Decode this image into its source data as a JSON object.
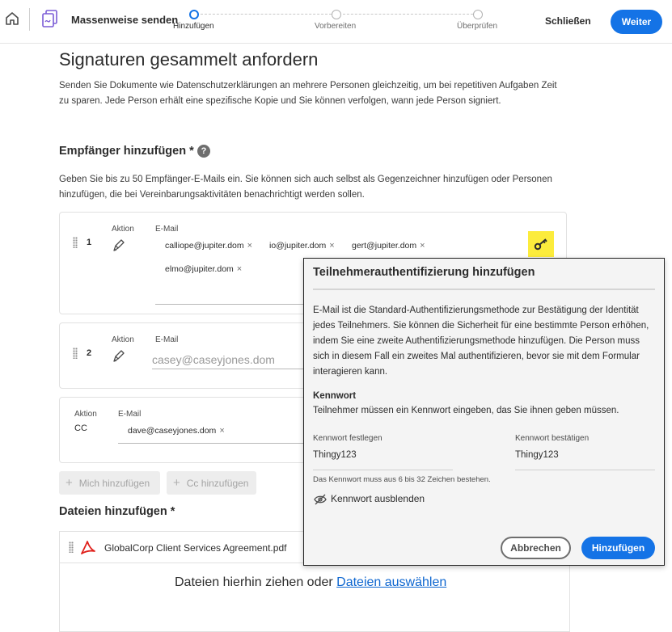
{
  "header": {
    "title": "Massenweise senden",
    "steps": [
      "Hinzufügen",
      "Vorbereiten",
      "Überprüfen"
    ],
    "close_label": "Schließen",
    "next_label": "Weiter"
  },
  "page": {
    "title": "Signaturen gesammelt anfordern",
    "intro": "Senden Sie Dokumente wie Datenschutzerklärungen an mehrere Personen gleichzeitig, um bei repetitiven Aufgaben Zeit zu sparen. Jede Person erhält eine spezifische Kopie und Sie können verfolgen, wann jede Person signiert."
  },
  "recipients": {
    "heading": "Empfänger hinzufügen *",
    "help": "?",
    "description": "Geben Sie bis zu 50 Empfänger-E-Mails ein. Sie können sich auch selbst als Gegenzeichner hinzufügen oder Personen hinzufügen, die bei Vereinbarungsaktivitäten benachrichtigt werden sollen.",
    "action_label": "Aktion",
    "email_label": "E-Mail",
    "row1": {
      "number": "1",
      "emails": [
        "calliope@jupiter.dom",
        "io@jupiter.dom",
        "gert@jupiter.dom",
        "elmo@jupiter.dom"
      ]
    },
    "row2": {
      "number": "2",
      "placeholder": "casey@caseyjones.dom"
    },
    "cc_row": {
      "action_value": "CC",
      "emails": [
        "dave@caseyjones.dom"
      ]
    },
    "remove_symbol": "×",
    "add_me_label": "Mich hinzufügen",
    "add_cc_label": "Cc hinzufügen",
    "plus_symbol": "+"
  },
  "files": {
    "heading": "Dateien hinzufügen *",
    "file_name": "GlobalCorp Client Services Agreement.pdf",
    "drop_text": "Dateien hierhin ziehen oder ",
    "drop_link": "Dateien auswählen"
  },
  "dialog": {
    "title": "Teilnehmerauthentifizierung hinzufügen",
    "body": "E-Mail ist die Standard-Authentifizierungsmethode zur Bestätigung der Identität jedes Teilnehmers. Sie können die Sicherheit für eine bestimmte Person erhöhen, indem Sie eine zweite Authentifizierungsmethode hinzufügen. Die Person muss sich in diesem Fall ein zweites Mal authentifizieren, bevor sie mit dem Formular interagieren kann.",
    "section_heading": "Kennwort",
    "section_text": "Teilnehmer müssen ein Kennwort eingeben, das Sie ihnen geben müssen.",
    "set_label": "Kennwort festlegen",
    "set_value": "Thingy123",
    "confirm_label": "Kennwort bestätigen",
    "confirm_value": "Thingy123",
    "hint": "Das Kennwort muss aus 6 bis 32 Zeichen bestehen.",
    "toggle_label": "Kennwort ausblenden",
    "cancel_label": "Abbrechen",
    "add_label": "Hinzufügen"
  },
  "colors": {
    "accent": "#1473e6",
    "highlight": "#fcec3c",
    "pdf_red": "#e0201b"
  }
}
